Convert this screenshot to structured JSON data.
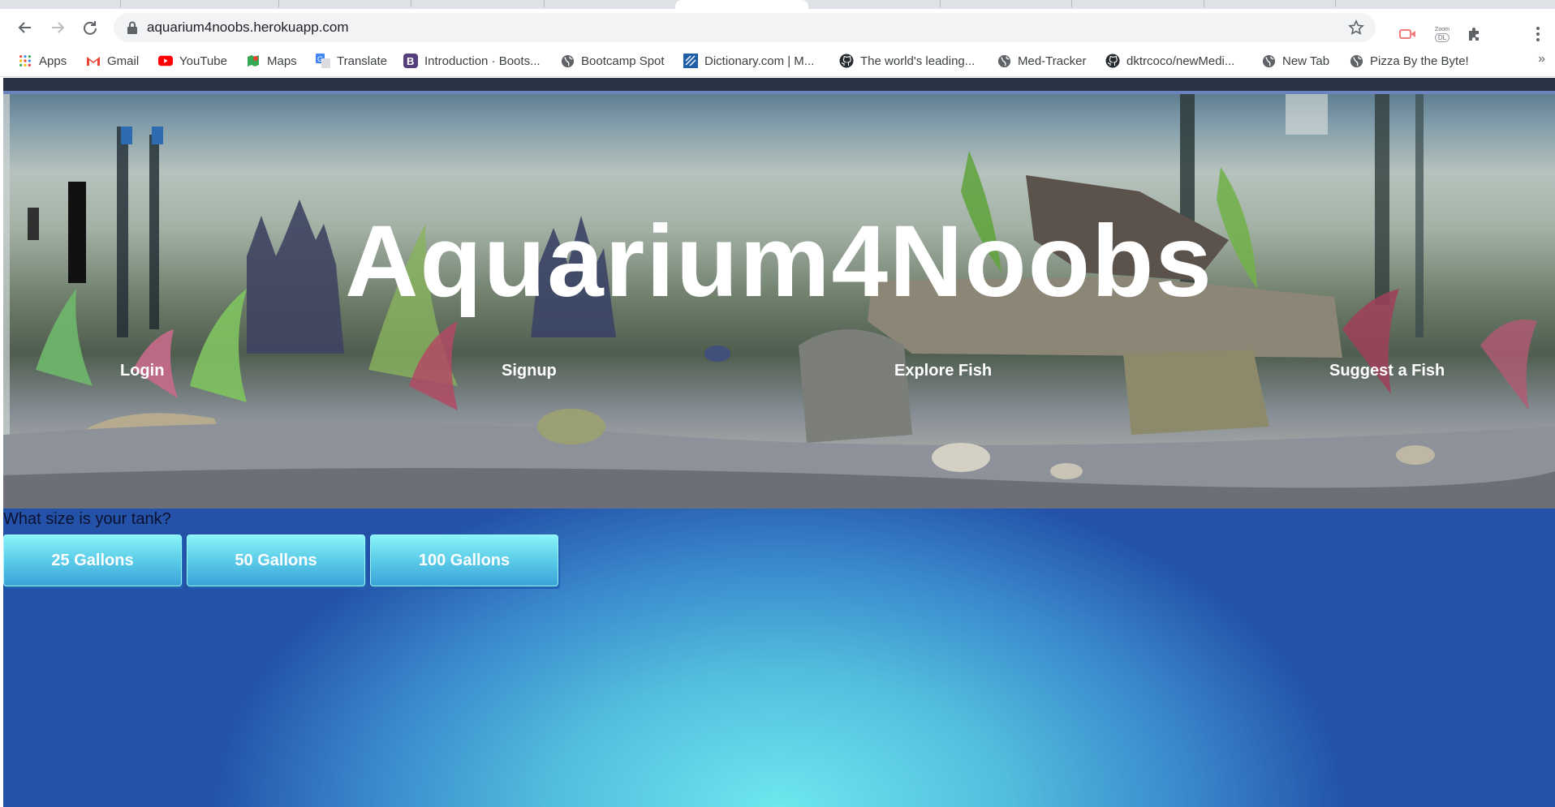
{
  "browser": {
    "url": "aquarium4noobs.herokuapp.com",
    "bookmarks": [
      {
        "label": "Apps",
        "icon": "apps-grid-icon"
      },
      {
        "label": "Gmail",
        "icon": "gmail-icon"
      },
      {
        "label": "YouTube",
        "icon": "youtube-icon"
      },
      {
        "label": "Maps",
        "icon": "maps-icon"
      },
      {
        "label": "Translate",
        "icon": "translate-icon"
      },
      {
        "label": "Introduction · Boots...",
        "icon": "bootstrap-icon"
      },
      {
        "label": "Bootcamp Spot",
        "icon": "globe-icon"
      },
      {
        "label": "Dictionary.com | M...",
        "icon": "dictionary-icon"
      },
      {
        "label": "The world's leading...",
        "icon": "github-icon"
      },
      {
        "label": "Med-Tracker",
        "icon": "globe-icon"
      },
      {
        "label": "dktrcoco/newMedi...",
        "icon": "github-icon"
      },
      {
        "label": "New Tab",
        "icon": "globe-icon"
      },
      {
        "label": "Pizza By the Byte!",
        "icon": "globe-icon"
      }
    ],
    "more_label": "»",
    "zoom_ext_label": "Zoom",
    "zoom_ext_sub": "DL"
  },
  "page": {
    "title": "Aquarium4Noobs",
    "nav": {
      "login": "Login",
      "signup": "Signup",
      "explore": "Explore Fish",
      "suggest": "Suggest a Fish"
    },
    "question": "What size is your tank?",
    "sizes": [
      "25 Gallons",
      "50 Gallons",
      "100 Gallons"
    ]
  },
  "colors": {
    "page_gradient_center": "#6ee8ee",
    "page_gradient_edge": "#2352a8",
    "button_top": "#8af4f8",
    "button_bottom": "#3ba3d9"
  }
}
